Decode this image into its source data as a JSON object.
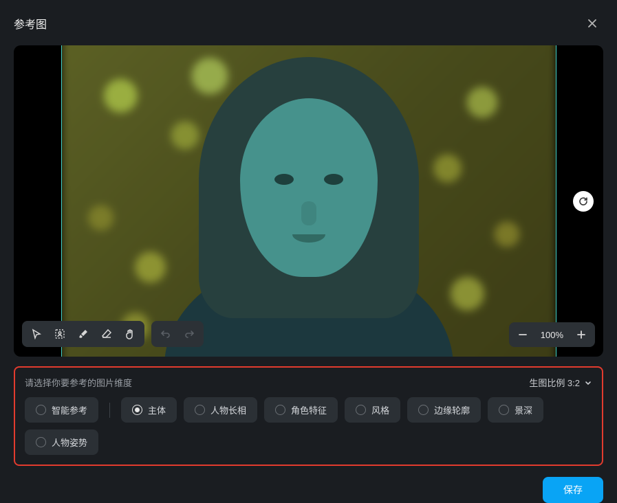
{
  "header": {
    "title": "参考图"
  },
  "canvas": {
    "zoom_value": "100%"
  },
  "dimension": {
    "prompt": "请选择你要参考的图片维度",
    "ratio_label": "生图比例 3:2",
    "options": [
      {
        "label": "智能参考",
        "selected": false
      },
      {
        "label": "主体",
        "selected": true
      },
      {
        "label": "人物长相",
        "selected": false
      },
      {
        "label": "角色特征",
        "selected": false
      },
      {
        "label": "风格",
        "selected": false
      },
      {
        "label": "边缘轮廓",
        "selected": false
      },
      {
        "label": "景深",
        "selected": false
      },
      {
        "label": "人物姿势",
        "selected": false
      }
    ]
  },
  "footer": {
    "save_label": "保存"
  }
}
